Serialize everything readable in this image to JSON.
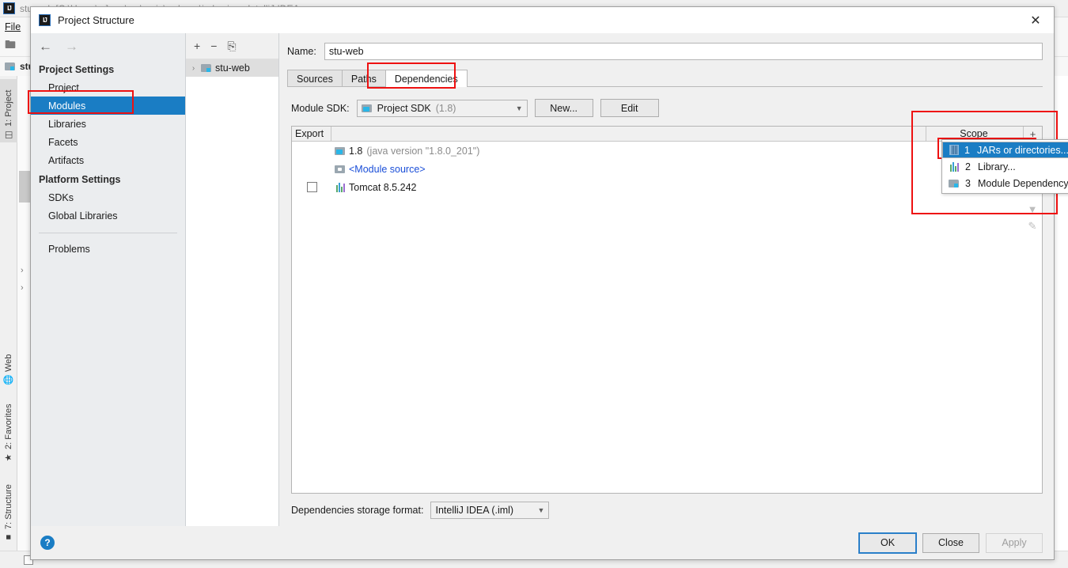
{
  "ide": {
    "window_title": "stu-web [C:\\Users\\...] - ...\\src\\main\\webapp\\index.jsp - IntelliJ IDEA",
    "menu": [
      {
        "label": "File"
      }
    ],
    "tool_tabs": [
      {
        "label": "1: Project",
        "icon": "project-icon",
        "active": true
      },
      {
        "label": "Web",
        "icon": "web-globe-icon",
        "active": false
      },
      {
        "label": "2: Favorites",
        "icon": "star-icon",
        "active": false
      },
      {
        "label": "7: Structure",
        "icon": "structure-icon",
        "active": false
      }
    ],
    "navbar_text": "stu-web"
  },
  "dialog": {
    "title": "Project Structure",
    "app_icon": "intellij-idea-logo",
    "close_icon": "close-icon",
    "nav": {
      "back_icon": "back-arrow-icon",
      "forward_icon": "forward-arrow-icon"
    },
    "sidebar": {
      "groups": [
        {
          "title": "Project Settings",
          "items": [
            {
              "label": "Project",
              "selected": false
            },
            {
              "label": "Modules",
              "selected": true
            },
            {
              "label": "Libraries",
              "selected": false
            },
            {
              "label": "Facets",
              "selected": false
            },
            {
              "label": "Artifacts",
              "selected": false
            }
          ]
        },
        {
          "title": "Platform Settings",
          "items": [
            {
              "label": "SDKs",
              "selected": false
            },
            {
              "label": "Global Libraries",
              "selected": false
            }
          ]
        }
      ],
      "problems_label": "Problems"
    },
    "tree": {
      "toolbar": [
        {
          "icon": "plus-icon",
          "label": "+"
        },
        {
          "icon": "minus-icon",
          "label": "−"
        },
        {
          "icon": "copy-icon",
          "label": "⎘"
        }
      ],
      "nodes": [
        {
          "label": "stu-web",
          "expander": "›",
          "icon": "module-folder-icon"
        }
      ]
    },
    "content": {
      "name_label": "Name:",
      "name_value": "stu-web",
      "tabs": [
        {
          "label": "Sources",
          "active": false
        },
        {
          "label": "Paths",
          "active": false
        },
        {
          "label": "Dependencies",
          "active": true
        }
      ],
      "sdk_label": "Module SDK:",
      "sdk_value": "Project SDK",
      "sdk_value_suffix": "(1.8)",
      "sdk_icon": "sdk-icon",
      "new_button": "New...",
      "edit_button": "Edit",
      "table": {
        "headers": {
          "export": "Export",
          "scope": "Scope"
        },
        "rows": [
          {
            "checkbox": null,
            "icon": "sdk-icon",
            "label": "1.8",
            "suffix": "(java version \"1.8.0_201\")",
            "style": "normal"
          },
          {
            "checkbox": null,
            "icon": "module-source-icon",
            "label": "<Module source>",
            "suffix": "",
            "style": "link"
          },
          {
            "checkbox": false,
            "icon": "library-icon",
            "label": "Tomcat 8.5.242",
            "suffix": "",
            "style": "normal"
          }
        ],
        "side_buttons": [
          {
            "icon": "plus-icon",
            "label": "+",
            "enabled": true
          },
          {
            "icon": "chevron-down-icon",
            "label": "▼",
            "enabled": false
          },
          {
            "icon": "edit-pencil-icon",
            "label": "✎",
            "enabled": false
          }
        ]
      },
      "add_menu": {
        "items": [
          {
            "num": "1",
            "label": "JARs or directories...",
            "icon": "jar-icon",
            "selected": true
          },
          {
            "num": "2",
            "label": "Library...",
            "icon": "library-icon",
            "selected": false
          },
          {
            "num": "3",
            "label": "Module Dependency...",
            "icon": "module-folder-icon",
            "selected": false
          }
        ]
      },
      "storage_label": "Dependencies storage format:",
      "storage_value": "IntelliJ IDEA (.iml)"
    },
    "footer": {
      "help_label": "?",
      "ok_label": "OK",
      "close_label": "Close",
      "apply_label": "Apply"
    }
  },
  "colors": {
    "selection_blue": "#1a7dc4",
    "annotation_red": "#ee1111",
    "link_blue": "#1b4fd8"
  }
}
